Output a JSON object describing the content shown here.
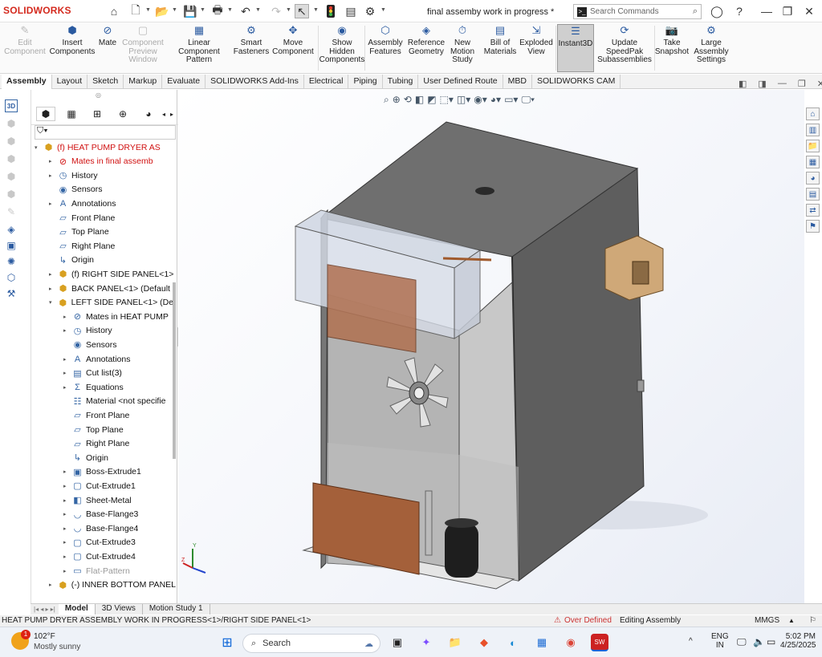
{
  "app": {
    "logo": "SOLIDWORKS",
    "doc_title": "final assemby work in progress *"
  },
  "search": {
    "placeholder": "Search Commands"
  },
  "commands": [
    {
      "label": "Edit\nComponent",
      "icon": "edit-component-icon",
      "enabled": false
    },
    {
      "label": "Insert\nComponents",
      "icon": "insert-components-icon",
      "enabled": true
    },
    {
      "label": "Mate",
      "icon": "mate-icon",
      "enabled": true
    },
    {
      "label": "Component\nPreview\nWindow",
      "icon": "component-preview-icon",
      "enabled": false
    },
    {
      "label": "Linear Component\nPattern",
      "icon": "linear-pattern-icon",
      "enabled": true
    },
    {
      "label": "Smart\nFasteners",
      "icon": "smart-fasteners-icon",
      "enabled": true
    },
    {
      "label": "Move\nComponent",
      "icon": "move-component-icon",
      "enabled": true
    },
    {
      "label": "Show\nHidden\nComponents",
      "icon": "show-hidden-icon",
      "enabled": true
    },
    {
      "label": "Assembly\nFeatures",
      "icon": "assembly-features-icon",
      "enabled": true
    },
    {
      "label": "Reference\nGeometry",
      "icon": "reference-geometry-icon",
      "enabled": true
    },
    {
      "label": "New\nMotion\nStudy",
      "icon": "motion-study-icon",
      "enabled": true
    },
    {
      "label": "Bill of\nMaterials",
      "icon": "bom-icon",
      "enabled": true
    },
    {
      "label": "Exploded\nView",
      "icon": "exploded-view-icon",
      "enabled": true
    },
    {
      "label": "Instant3D",
      "icon": "instant3d-icon",
      "enabled": true,
      "active": true
    },
    {
      "label": "Update\nSpeedPak\nSubassemblies",
      "icon": "speedpak-icon",
      "enabled": true
    },
    {
      "label": "Take\nSnapshot",
      "icon": "snapshot-icon",
      "enabled": true
    },
    {
      "label": "Large\nAssembly\nSettings",
      "icon": "large-assembly-icon",
      "enabled": true
    }
  ],
  "tabs": [
    "Assembly",
    "Layout",
    "Sketch",
    "Markup",
    "Evaluate",
    "SOLIDWORKS Add-Ins",
    "Electrical",
    "Piping",
    "Tubing",
    "User Defined Route",
    "MBD",
    "SOLIDWORKS CAM"
  ],
  "tree": [
    {
      "indent": 0,
      "arrow": "▾",
      "icon": "assembly-icon",
      "text": "(f) HEAT PUMP DRYER AS",
      "style": "red"
    },
    {
      "indent": 1,
      "arrow": "▸",
      "icon": "mates-error-icon",
      "text": "Mates in final assemb",
      "style": "red"
    },
    {
      "indent": 1,
      "arrow": "▸",
      "icon": "history-icon",
      "text": "History"
    },
    {
      "indent": 1,
      "arrow": "",
      "icon": "sensors-icon",
      "text": "Sensors"
    },
    {
      "indent": 1,
      "arrow": "▸",
      "icon": "annotations-icon",
      "text": "Annotations"
    },
    {
      "indent": 1,
      "arrow": "",
      "icon": "plane-icon",
      "text": "Front Plane"
    },
    {
      "indent": 1,
      "arrow": "",
      "icon": "plane-icon",
      "text": "Top Plane"
    },
    {
      "indent": 1,
      "arrow": "",
      "icon": "plane-icon",
      "text": "Right Plane"
    },
    {
      "indent": 1,
      "arrow": "",
      "icon": "origin-icon",
      "text": "Origin"
    },
    {
      "indent": 1,
      "arrow": "▸",
      "icon": "part-icon",
      "text": "(f) RIGHT SIDE PANEL<1>"
    },
    {
      "indent": 1,
      "arrow": "▸",
      "icon": "part-icon",
      "text": "BACK PANEL<1> (Default"
    },
    {
      "indent": 1,
      "arrow": "▾",
      "icon": "part-icon",
      "text": "LEFT SIDE PANEL<1> (Def"
    },
    {
      "indent": 2,
      "arrow": "▸",
      "icon": "mates-icon",
      "text": "Mates in HEAT PUMP"
    },
    {
      "indent": 2,
      "arrow": "▸",
      "icon": "history-icon",
      "text": "History"
    },
    {
      "indent": 2,
      "arrow": "",
      "icon": "sensors-icon",
      "text": "Sensors"
    },
    {
      "indent": 2,
      "arrow": "▸",
      "icon": "annotations-icon",
      "text": "Annotations"
    },
    {
      "indent": 2,
      "arrow": "▸",
      "icon": "cutlist-icon",
      "text": "Cut list(3)"
    },
    {
      "indent": 2,
      "arrow": "▸",
      "icon": "equations-icon",
      "text": "Equations"
    },
    {
      "indent": 2,
      "arrow": "",
      "icon": "material-icon",
      "text": "Material <not specifie"
    },
    {
      "indent": 2,
      "arrow": "",
      "icon": "plane-icon",
      "text": "Front Plane"
    },
    {
      "indent": 2,
      "arrow": "",
      "icon": "plane-icon",
      "text": "Top Plane"
    },
    {
      "indent": 2,
      "arrow": "",
      "icon": "plane-icon",
      "text": "Right Plane"
    },
    {
      "indent": 2,
      "arrow": "",
      "icon": "origin-icon",
      "text": "Origin"
    },
    {
      "indent": 2,
      "arrow": "▸",
      "icon": "boss-extrude-icon",
      "text": "Boss-Extrude1"
    },
    {
      "indent": 2,
      "arrow": "▸",
      "icon": "cut-extrude-icon",
      "text": "Cut-Extrude1"
    },
    {
      "indent": 2,
      "arrow": "▸",
      "icon": "sheet-metal-icon",
      "text": "Sheet-Metal"
    },
    {
      "indent": 2,
      "arrow": "▸",
      "icon": "base-flange-icon",
      "text": "Base-Flange3"
    },
    {
      "indent": 2,
      "arrow": "▸",
      "icon": "base-flange-icon",
      "text": "Base-Flange4"
    },
    {
      "indent": 2,
      "arrow": "▸",
      "icon": "cut-extrude-icon",
      "text": "Cut-Extrude3"
    },
    {
      "indent": 2,
      "arrow": "▸",
      "icon": "cut-extrude-icon",
      "text": "Cut-Extrude4"
    },
    {
      "indent": 2,
      "arrow": "▸",
      "icon": "flat-pattern-icon",
      "text": "Flat-Pattern",
      "style": "grey"
    },
    {
      "indent": 1,
      "arrow": "▸",
      "icon": "part-icon",
      "text": "(-) INNER BOTTOM PANEL"
    }
  ],
  "bottom_tabs": [
    "Model",
    "3D Views",
    "Motion Study 1"
  ],
  "status": {
    "path": "HEAT PUMP DRYER ASSEMBLY WORK IN PROGRESS<1>/RIGHT SIDE PANEL<1>",
    "warning": "Over Defined",
    "mode": "Editing Assembly",
    "units": "MMGS"
  },
  "taskbar": {
    "weather_temp": "102°F",
    "weather_desc": "Mostly sunny",
    "weather_badge": "1",
    "search_label": "Search",
    "lang1": "ENG",
    "lang2": "IN",
    "time": "5:02 PM",
    "date": "4/25/2025"
  },
  "colors": {
    "accent": "#d42a1e",
    "active_tab": "#ffffff",
    "cabinet": "#7a7a7a",
    "coil": "#a4603a"
  }
}
